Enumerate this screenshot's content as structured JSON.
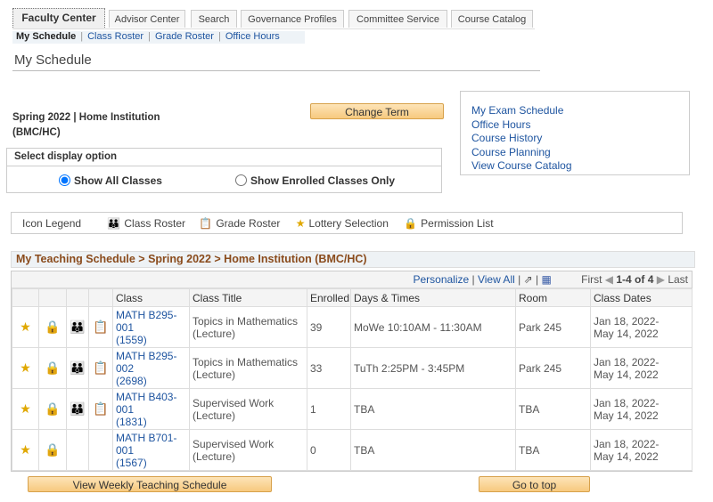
{
  "tabs": [
    "Faculty Center",
    "Advisor Center",
    "Search",
    "Governance Profiles",
    "Committee Service",
    "Course Catalog"
  ],
  "subnav": {
    "current": "My Schedule",
    "links": [
      "Class Roster",
      "Grade Roster",
      "Office Hours"
    ]
  },
  "page_title": "My Schedule",
  "term": {
    "line1": "Spring 2022 | Home Institution",
    "line2": "(BMC/HC)",
    "change_term": "Change Term"
  },
  "display_option": {
    "label": "Select display option",
    "options": [
      "Show All Classes",
      "Show Enrolled Classes Only"
    ],
    "selected": "Show All Classes"
  },
  "side_links": [
    "My Exam Schedule",
    "Office Hours",
    "Course History",
    "Course Planning",
    "View Course Catalog"
  ],
  "legend": {
    "title": "Icon Legend",
    "items": [
      {
        "icon": "class-roster-icon",
        "label": "Class Roster"
      },
      {
        "icon": "grade-roster-icon",
        "label": "Grade Roster"
      },
      {
        "icon": "star-icon",
        "label": "Lottery Selection"
      },
      {
        "icon": "lock-icon",
        "label": "Permission List"
      }
    ]
  },
  "schedule": {
    "title": "My Teaching Schedule > Spring 2022 > Home Institution (BMC/HC)",
    "toolbar": {
      "personalize": "Personalize",
      "view_all": "View All",
      "first": "First",
      "range": "1-4 of 4",
      "last": "Last"
    },
    "columns": [
      "Class",
      "Class Title",
      "Enrolled",
      "Days & Times",
      "Room",
      "Class Dates"
    ],
    "rows": [
      {
        "class": [
          "MATH B295-",
          "001",
          "(1559)"
        ],
        "title": [
          "Topics in Mathematics",
          "(Lecture)"
        ],
        "enrolled": "39",
        "days": "MoWe 10:10AM - 11:30AM",
        "room": "Park 245",
        "dates": [
          "Jan 18, 2022-",
          "May 14, 2022"
        ],
        "roster": true
      },
      {
        "class": [
          "MATH B295-",
          "002",
          "(2698)"
        ],
        "title": [
          "Topics in Mathematics",
          "(Lecture)"
        ],
        "enrolled": "33",
        "days": "TuTh 2:25PM - 3:45PM",
        "room": "Park 245",
        "dates": [
          "Jan 18, 2022-",
          "May 14, 2022"
        ],
        "roster": true
      },
      {
        "class": [
          "MATH B403-",
          "001",
          "(1831)"
        ],
        "title": [
          "Supervised Work",
          "(Lecture)"
        ],
        "enrolled": "1",
        "days": "TBA",
        "room": "TBA",
        "dates": [
          "Jan 18, 2022-",
          "May 14, 2022"
        ],
        "roster": true
      },
      {
        "class": [
          "MATH B701-",
          "001",
          "(1567)"
        ],
        "title": [
          "Supervised Work",
          "(Lecture)"
        ],
        "enrolled": "0",
        "days": "TBA",
        "room": "TBA",
        "dates": [
          "Jan 18, 2022-",
          "May 14, 2022"
        ],
        "roster": false
      }
    ]
  },
  "buttons": {
    "weekly": "View Weekly Teaching Schedule",
    "top": "Go to top"
  },
  "colors": {
    "link": "#1f55a0",
    "header_brown": "#8a4b1c",
    "button": "#f7c97e"
  }
}
